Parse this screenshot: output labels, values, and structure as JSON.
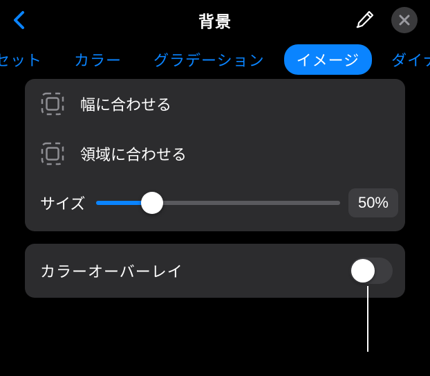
{
  "header": {
    "title": "背景"
  },
  "tabs": {
    "items": [
      {
        "label": "セット"
      },
      {
        "label": "カラー"
      },
      {
        "label": "グラデーション"
      },
      {
        "label": "イメージ",
        "active": true
      },
      {
        "label": "ダイナミ"
      }
    ]
  },
  "options": {
    "fitWidth": "幅に合わせる",
    "fitArea": "領域に合わせる"
  },
  "size": {
    "label": "サイズ",
    "value": "50%",
    "percent": 50
  },
  "overlay": {
    "label": "カラーオーバーレイ",
    "on": false
  },
  "colors": {
    "accent": "#0a84ff",
    "panel": "#2c2c2e",
    "bg": "#000000"
  }
}
